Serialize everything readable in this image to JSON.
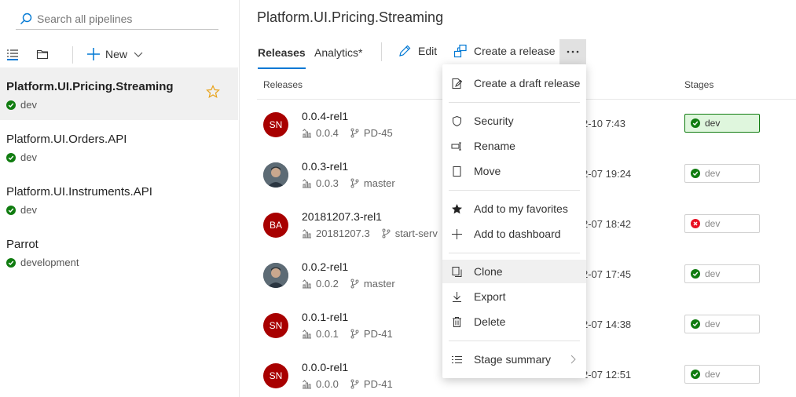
{
  "sidebar": {
    "search_placeholder": "Search all pipelines",
    "new_label": "New",
    "pipelines": [
      {
        "name": "Platform.UI.Pricing.Streaming",
        "env": "dev",
        "selected": true
      },
      {
        "name": "Platform.UI.Orders.API",
        "env": "dev"
      },
      {
        "name": "Platform.UI.Instruments.API",
        "env": "dev"
      },
      {
        "name": "Parrot",
        "env": "development"
      }
    ]
  },
  "header": {
    "title": "Platform.UI.Pricing.Streaming",
    "tabs": [
      "Releases",
      "Analytics*"
    ],
    "actions": {
      "edit": "Edit",
      "create_release": "Create a release",
      "more": "···"
    }
  },
  "table": {
    "columns": {
      "releases": "Releases",
      "stages": "Stages"
    },
    "rows": [
      {
        "name": "0.0.4-rel1",
        "build": "0.0.4",
        "branch": "PD-45",
        "date": "2-10 7:43",
        "avatar": "SN",
        "stage": "dev",
        "stage_status": "success"
      },
      {
        "name": "0.0.3-rel1",
        "build": "0.0.3",
        "branch": "master",
        "date": "2-07 19:24",
        "avatar": "",
        "stage": "dev",
        "stage_status": "success"
      },
      {
        "name": "20181207.3-rel1",
        "build": "20181207.3",
        "branch": "start-serv",
        "date": "2-07 18:42",
        "avatar": "BA",
        "stage": "dev",
        "stage_status": "failed"
      },
      {
        "name": "0.0.2-rel1",
        "build": "0.0.2",
        "branch": "master",
        "date": "2-07 17:45",
        "avatar": "",
        "stage": "dev",
        "stage_status": "success"
      },
      {
        "name": "0.0.1-rel1",
        "build": "0.0.1",
        "branch": "PD-41",
        "date": "2-07 14:38",
        "avatar": "SN",
        "stage": "dev",
        "stage_status": "success"
      },
      {
        "name": "0.0.0-rel1",
        "build": "0.0.0",
        "branch": "PD-41",
        "date": "2-07 12:51",
        "avatar": "SN",
        "stage": "dev",
        "stage_status": "success"
      }
    ]
  },
  "menu": {
    "items": [
      {
        "label": "Create a draft release",
        "icon": "draft-icon"
      },
      {
        "label": "Security",
        "icon": "shield-icon"
      },
      {
        "label": "Rename",
        "icon": "rename-icon"
      },
      {
        "label": "Move",
        "icon": "move-icon"
      },
      {
        "label": "Add to my favorites",
        "icon": "star-filled-icon"
      },
      {
        "label": "Add to dashboard",
        "icon": "plus-icon"
      },
      {
        "label": "Clone",
        "icon": "clone-icon",
        "hovered": true
      },
      {
        "label": "Export",
        "icon": "download-icon"
      },
      {
        "label": "Delete",
        "icon": "trash-icon"
      },
      {
        "label": "Stage summary",
        "icon": "list-icon",
        "submenu": true
      }
    ]
  },
  "colors": {
    "accent": "#0078d4",
    "success": "#107c10",
    "error": "#e81123",
    "avatar_red": "#a80000",
    "star": "#e8a31b"
  }
}
